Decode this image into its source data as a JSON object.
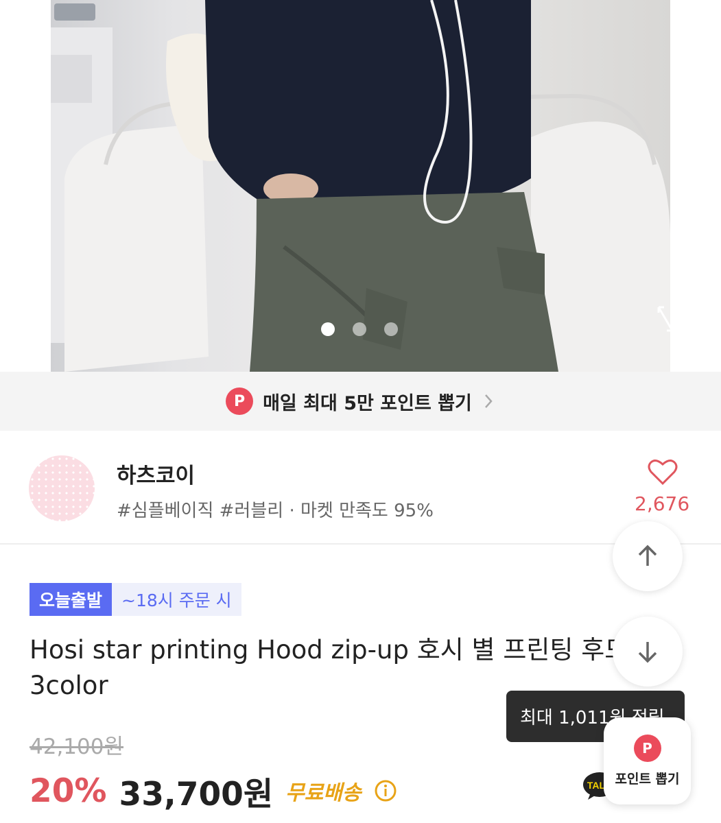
{
  "gallery": {
    "dots_total": 3,
    "active_dot": 1,
    "expand_icon": "expand-icon"
  },
  "points_banner": {
    "badge": "P",
    "text": "매일 최대 5만 포인트 뽑기",
    "chevron_icon": "chevron-right-icon"
  },
  "shop": {
    "name": "하츠코이",
    "tags": "#심플베이직 #러블리 · 마켓 만족도 95%",
    "like_count": "2,676",
    "heart_icon": "heart-outline-icon"
  },
  "product": {
    "badge_today": "오늘출발",
    "badge_time": "~18시 주문 시",
    "title": "Hosi star printing Hood zip-up 호시 별 프린팅 후드 집업 3color",
    "original_price": "42,100원",
    "discount": "20%",
    "price": "33,700원",
    "shipping": "무료배송",
    "info_icon": "info-circle-icon"
  },
  "floating": {
    "scroll_up_icon": "arrow-up-icon",
    "scroll_down_icon": "arrow-down-icon",
    "tooltip": "최대 1,011원 적립",
    "fab_badge": "P",
    "fab_label": "포인트 뽑기",
    "talk_icon": "talk-icon",
    "talk_text": "TALK"
  },
  "colors": {
    "accent_red": "#e0565e",
    "point_badge": "#eb4b5b",
    "today_blue": "#5a6bf2",
    "shipping_orange": "#e8a317"
  }
}
